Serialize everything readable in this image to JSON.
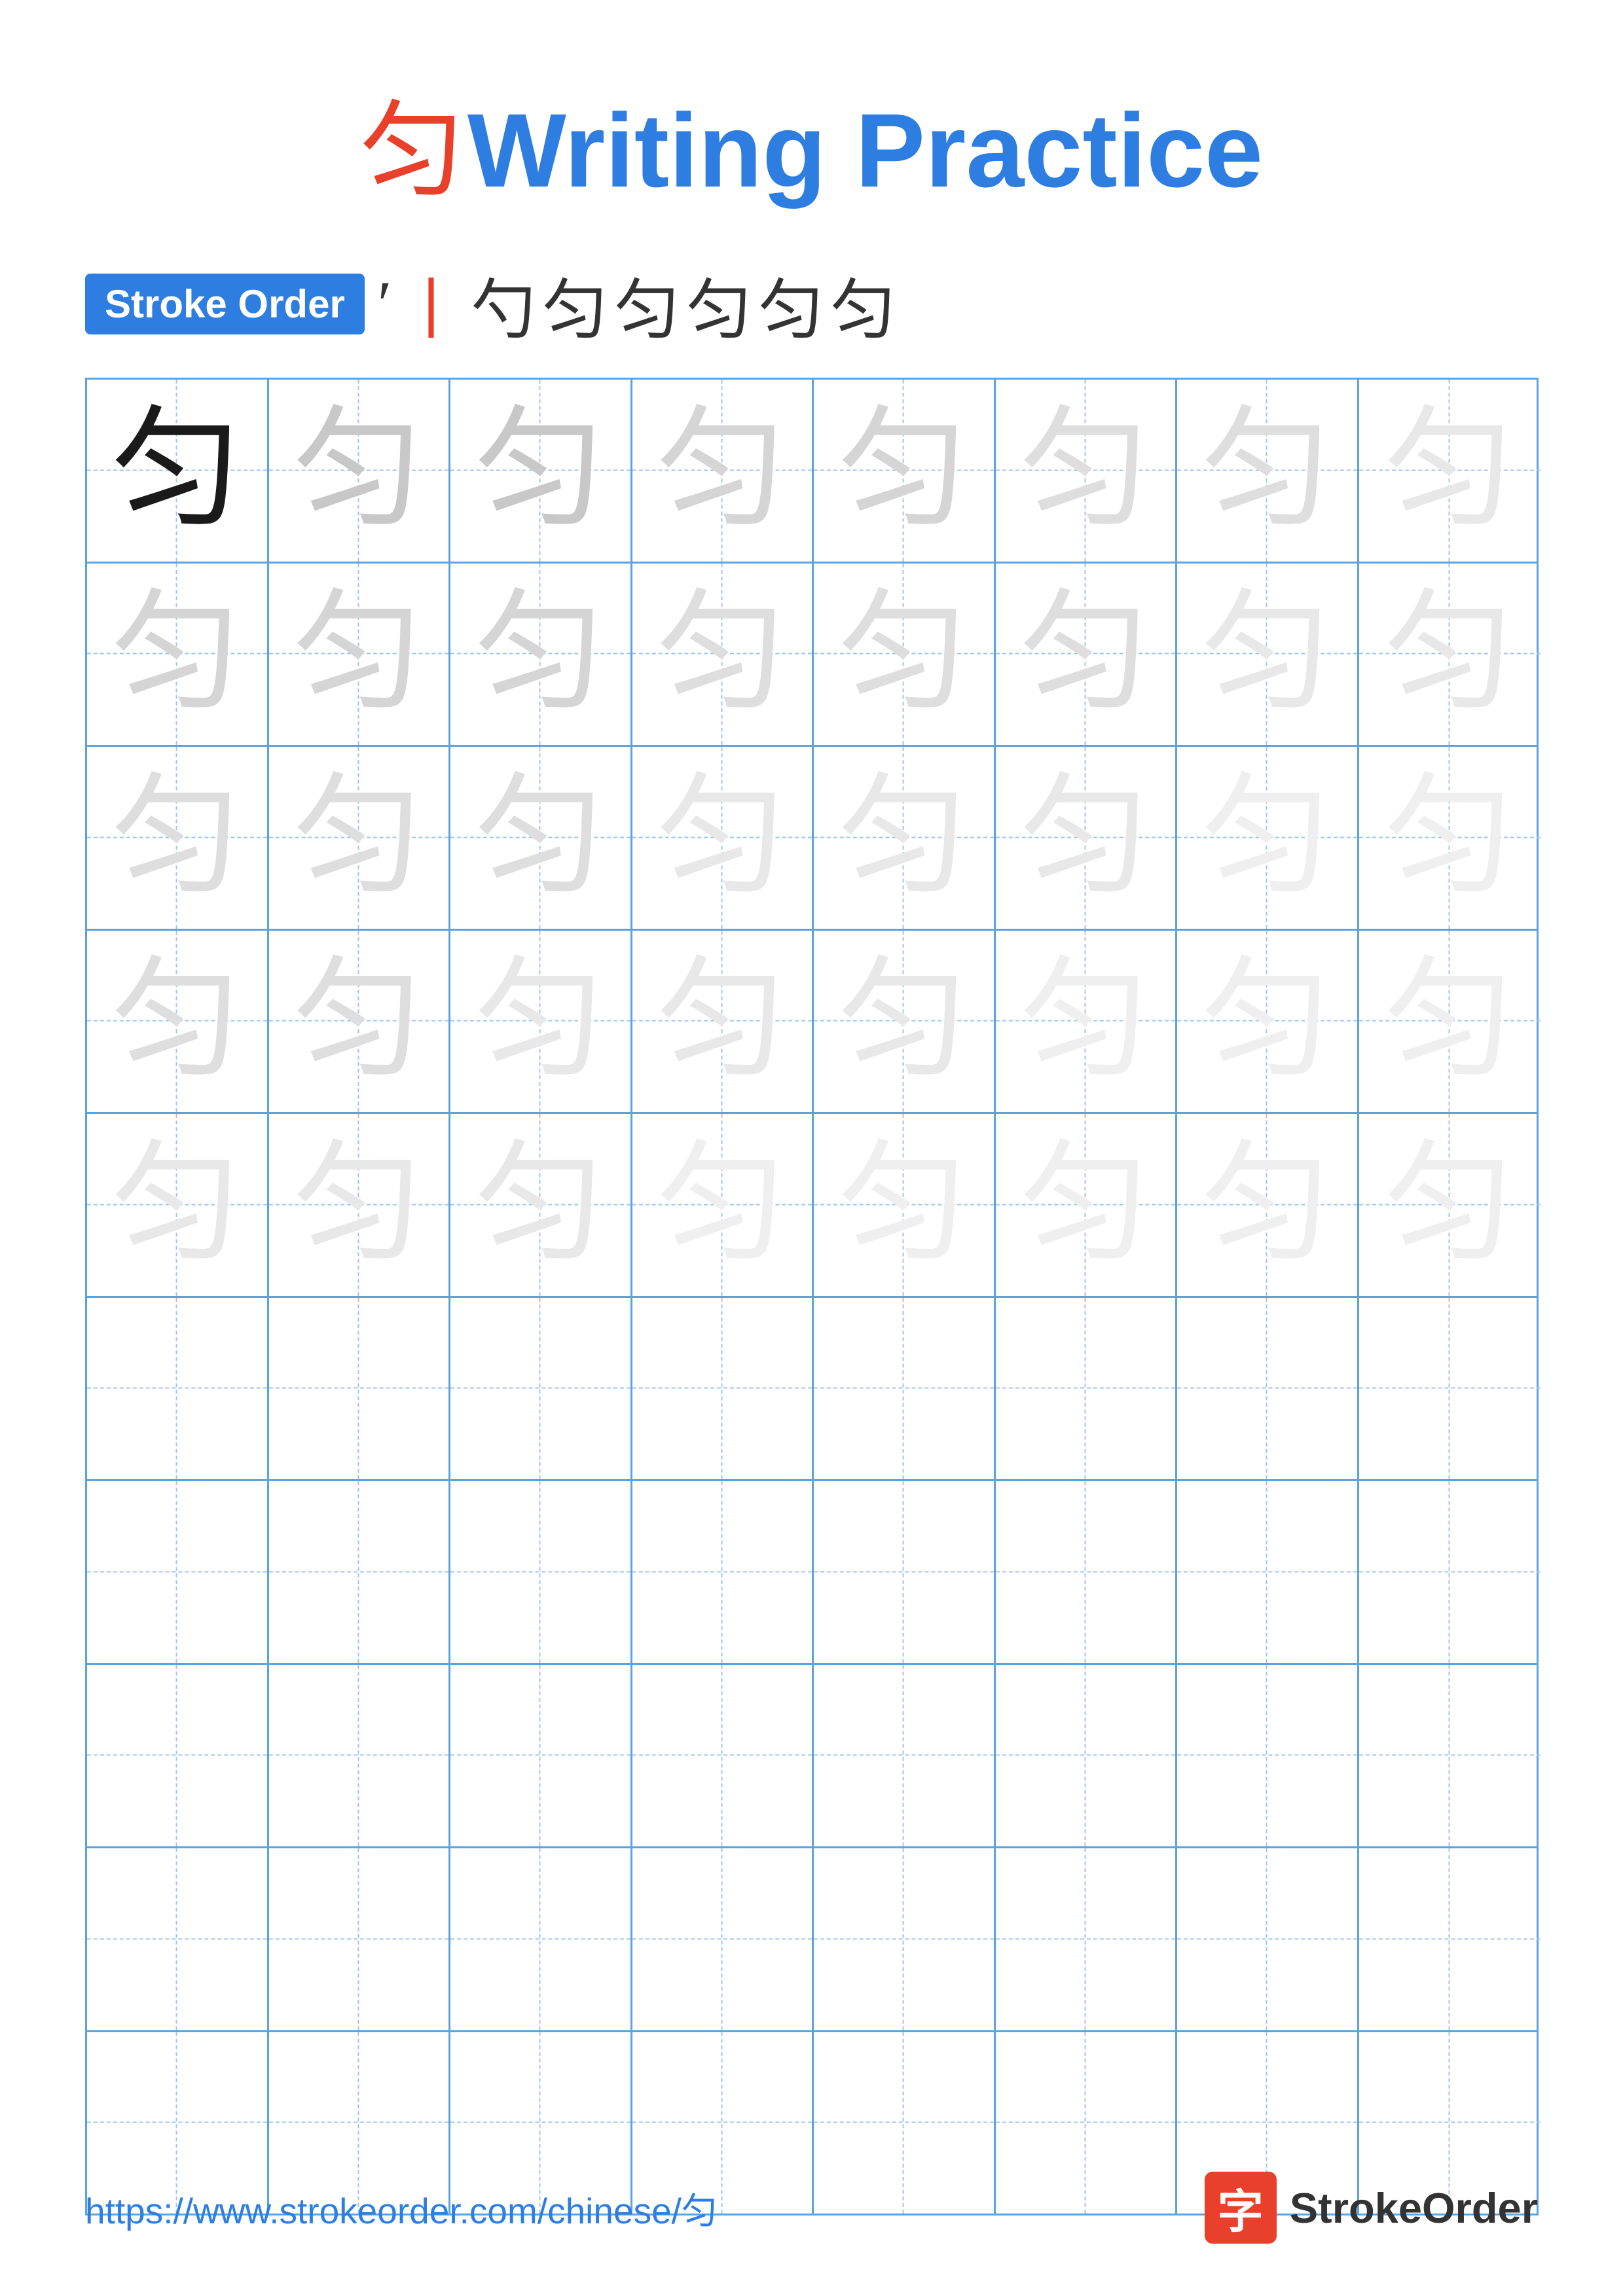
{
  "title": {
    "chinese_char": "匀",
    "english_text": "Writing Practice"
  },
  "stroke_order": {
    "badge_label": "Stroke Order",
    "apostrophe": "′",
    "strokes": [
      "丨",
      "勺",
      "匀",
      "匀",
      "匀",
      "匀",
      "匀"
    ]
  },
  "grid": {
    "rows": 10,
    "cols": 8,
    "character": "匀",
    "practice_rows": 5,
    "empty_rows": 5
  },
  "footer": {
    "url": "https://www.strokeorder.com/chinese/匀",
    "logo_char": "字",
    "logo_text": "StrokeOrder"
  }
}
